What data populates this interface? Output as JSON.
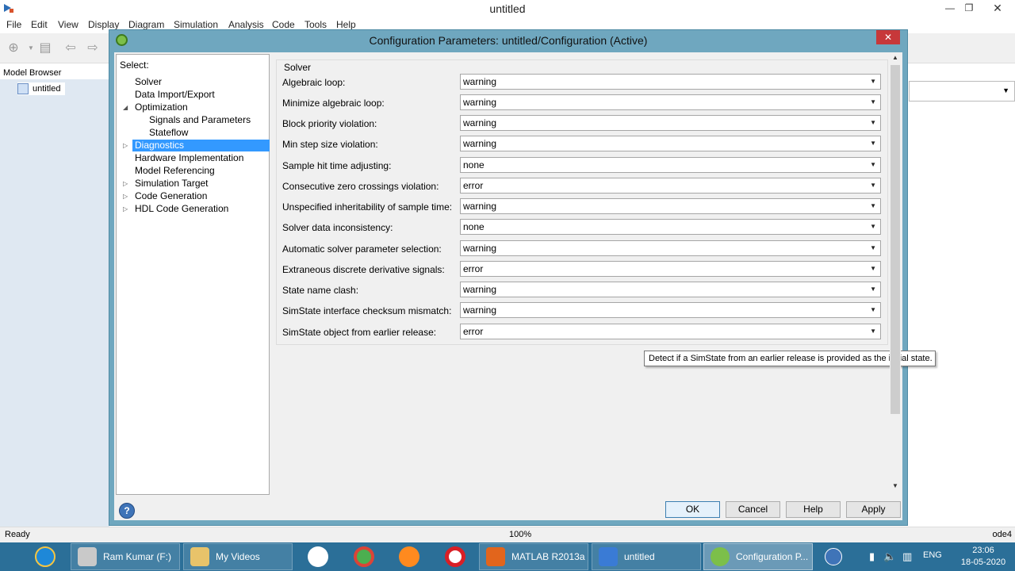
{
  "main_window": {
    "title": "untitled",
    "menu": [
      "File",
      "Edit",
      "View",
      "Display",
      "Diagram",
      "Simulation",
      "Analysis",
      "Code",
      "Tools",
      "Help"
    ],
    "model_browser_label": "Model Browser",
    "model_browser_item": "untitled",
    "status": {
      "left": "Ready",
      "zoom": "100%",
      "solver": "ode4"
    }
  },
  "dialog": {
    "title": "Configuration Parameters: untitled/Configuration (Active)",
    "close_label": "✕",
    "select_label": "Select:",
    "tree": [
      {
        "label": "Solver"
      },
      {
        "label": "Data Import/Export"
      },
      {
        "label": "Optimization",
        "arrow": "◢"
      },
      {
        "label": "Signals and Parameters"
      },
      {
        "label": "Stateflow"
      },
      {
        "label": "Diagnostics",
        "arrow": "▷",
        "selected": true
      },
      {
        "label": "Hardware Implementation"
      },
      {
        "label": "Model Referencing"
      },
      {
        "label": "Simulation Target",
        "arrow": "▷"
      },
      {
        "label": "Code Generation",
        "arrow": "▷"
      },
      {
        "label": "HDL Code Generation",
        "arrow": "▷"
      }
    ],
    "group_title": "Solver",
    "params": [
      {
        "label": "Algebraic loop:",
        "value": "warning"
      },
      {
        "label": "Minimize algebraic loop:",
        "value": "warning"
      },
      {
        "label": "Block priority violation:",
        "value": "warning"
      },
      {
        "label": "Min step size violation:",
        "value": "warning"
      },
      {
        "label": "Sample hit time adjusting:",
        "value": "none"
      },
      {
        "label": "Consecutive zero crossings violation:",
        "value": "error"
      },
      {
        "label": "Unspecified inheritability of sample time:",
        "value": "warning"
      },
      {
        "label": "Solver data inconsistency:",
        "value": "none"
      },
      {
        "label": "Automatic solver parameter selection:",
        "value": "warning"
      },
      {
        "label": "Extraneous discrete derivative signals:",
        "value": "error"
      },
      {
        "label": "State name clash:",
        "value": "warning"
      },
      {
        "label": "SimState interface checksum mismatch:",
        "value": "warning"
      },
      {
        "label": "SimState object from earlier release:",
        "value": "error"
      }
    ],
    "tooltip": "Detect if a SimState from an earlier release is provided as the initial state.",
    "buttons": {
      "ok": "OK",
      "cancel": "Cancel",
      "help": "Help",
      "apply": "Apply"
    },
    "help_icon": "?"
  },
  "taskbar": {
    "tasks": [
      {
        "label": "Ram Kumar (F:)"
      },
      {
        "label": "My Videos"
      },
      {
        "label": "MATLAB R2013a"
      },
      {
        "label": "untitled"
      },
      {
        "label": "Configuration P..."
      }
    ],
    "language": "ENG",
    "time": "23:06",
    "date": "18-05-2020"
  },
  "colors": {
    "dialog_frame": "#6fa7bf",
    "selection": "#3399ff",
    "taskbar": "#2b6f98",
    "close_button": "#c7383a"
  },
  "icons": [
    "simulink-app-icon",
    "config-gear-icon",
    "help-icon",
    "chevron-down-icon",
    "ie-icon",
    "drive-icon",
    "folder-video-icon",
    "hp-icon",
    "chrome-icon",
    "firefox-icon",
    "opera-icon",
    "matlab-icon",
    "simulink-icon",
    "gear-icon",
    "help-tray-icon",
    "battery-icon",
    "volume-icon",
    "network-icon"
  ]
}
